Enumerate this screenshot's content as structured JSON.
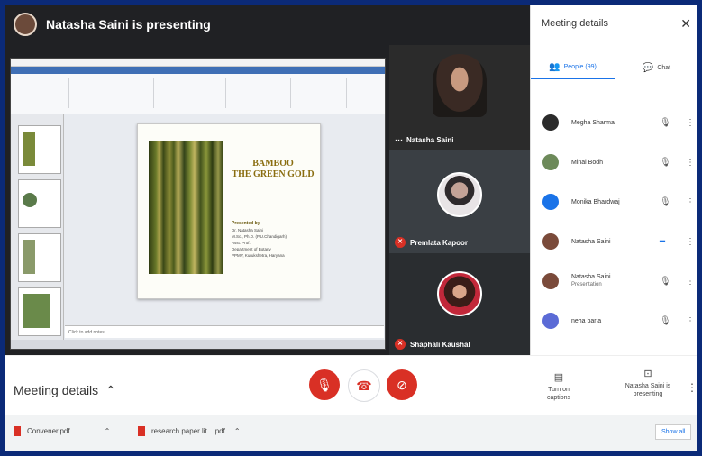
{
  "presenter_banner": "Natasha Saini is presenting",
  "slide": {
    "title_line1": "BAMBOO",
    "title_line2": "THE GREEN GOLD",
    "presented_by": "Presented by",
    "name": "Dr. Natasha Saini",
    "degrees": "M.Sc., Ph.D. (P.U.Chandigarh)",
    "role": "Asst. Prof.",
    "dept": "Department of Botany",
    "college": "PPMV, Kurukshetra, Haryana",
    "notes_placeholder": "Click to add notes"
  },
  "tiles": [
    {
      "name": "Natasha Saini"
    },
    {
      "name": "Premlata Kapoor"
    },
    {
      "name": "Shaphali Kaushal"
    }
  ],
  "panel": {
    "title": "Meeting details",
    "tabs": [
      {
        "label": "People (99)"
      },
      {
        "label": "Chat"
      }
    ],
    "people": [
      {
        "name": "Megha Sharma",
        "sub": "",
        "color": "#2b2b2b",
        "muted": true
      },
      {
        "name": "Minal Bodh",
        "sub": "",
        "color": "#6d8a5a",
        "muted": true
      },
      {
        "name": "Monika Bhardwaj",
        "sub": "",
        "color": "#1a73e8",
        "muted": true
      },
      {
        "name": "Natasha Saini",
        "sub": "",
        "color": "#7a4a3a",
        "muted": false
      },
      {
        "name": "Natasha Saini",
        "sub": "Presentation",
        "color": "#7a4a3a",
        "muted": true
      },
      {
        "name": "neha barla",
        "sub": "",
        "color": "#5b6bd6",
        "muted": true
      }
    ]
  },
  "bottom": {
    "meeting_details": "Meeting details",
    "captions": "Turn on captions",
    "presenting": "Natasha Saini is presenting"
  },
  "downloads": {
    "items": [
      {
        "name": "Convener.pdf"
      },
      {
        "name": "research paper lit....pdf"
      }
    ],
    "show_all": "Show all"
  },
  "colors": {
    "accent": "#1a73e8",
    "danger": "#d93025",
    "stage": "#202124"
  }
}
